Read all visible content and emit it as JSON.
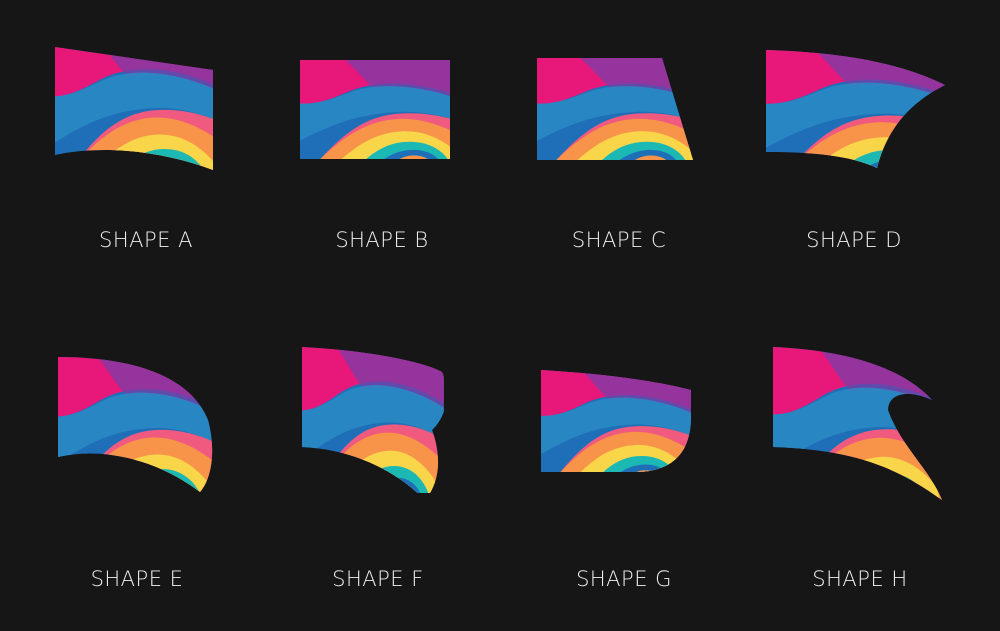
{
  "shapes": [
    {
      "id": "a",
      "label": "SHAPE A"
    },
    {
      "id": "b",
      "label": "SHAPE B"
    },
    {
      "id": "c",
      "label": "SHAPE C"
    },
    {
      "id": "d",
      "label": "SHAPE D"
    },
    {
      "id": "e",
      "label": "SHAPE E"
    },
    {
      "id": "f",
      "label": "SHAPE F"
    },
    {
      "id": "g",
      "label": "SHAPE G"
    },
    {
      "id": "h",
      "label": "SHAPE H"
    }
  ],
  "colors": {
    "background": "#161616",
    "magenta": "#e8187a",
    "purple": "#6a3fa0",
    "blue": "#1e6fb8",
    "teal": "#1bb8b4",
    "orange": "#f7944a",
    "yellow": "#f9d54a",
    "pink": "#f05a7e"
  }
}
